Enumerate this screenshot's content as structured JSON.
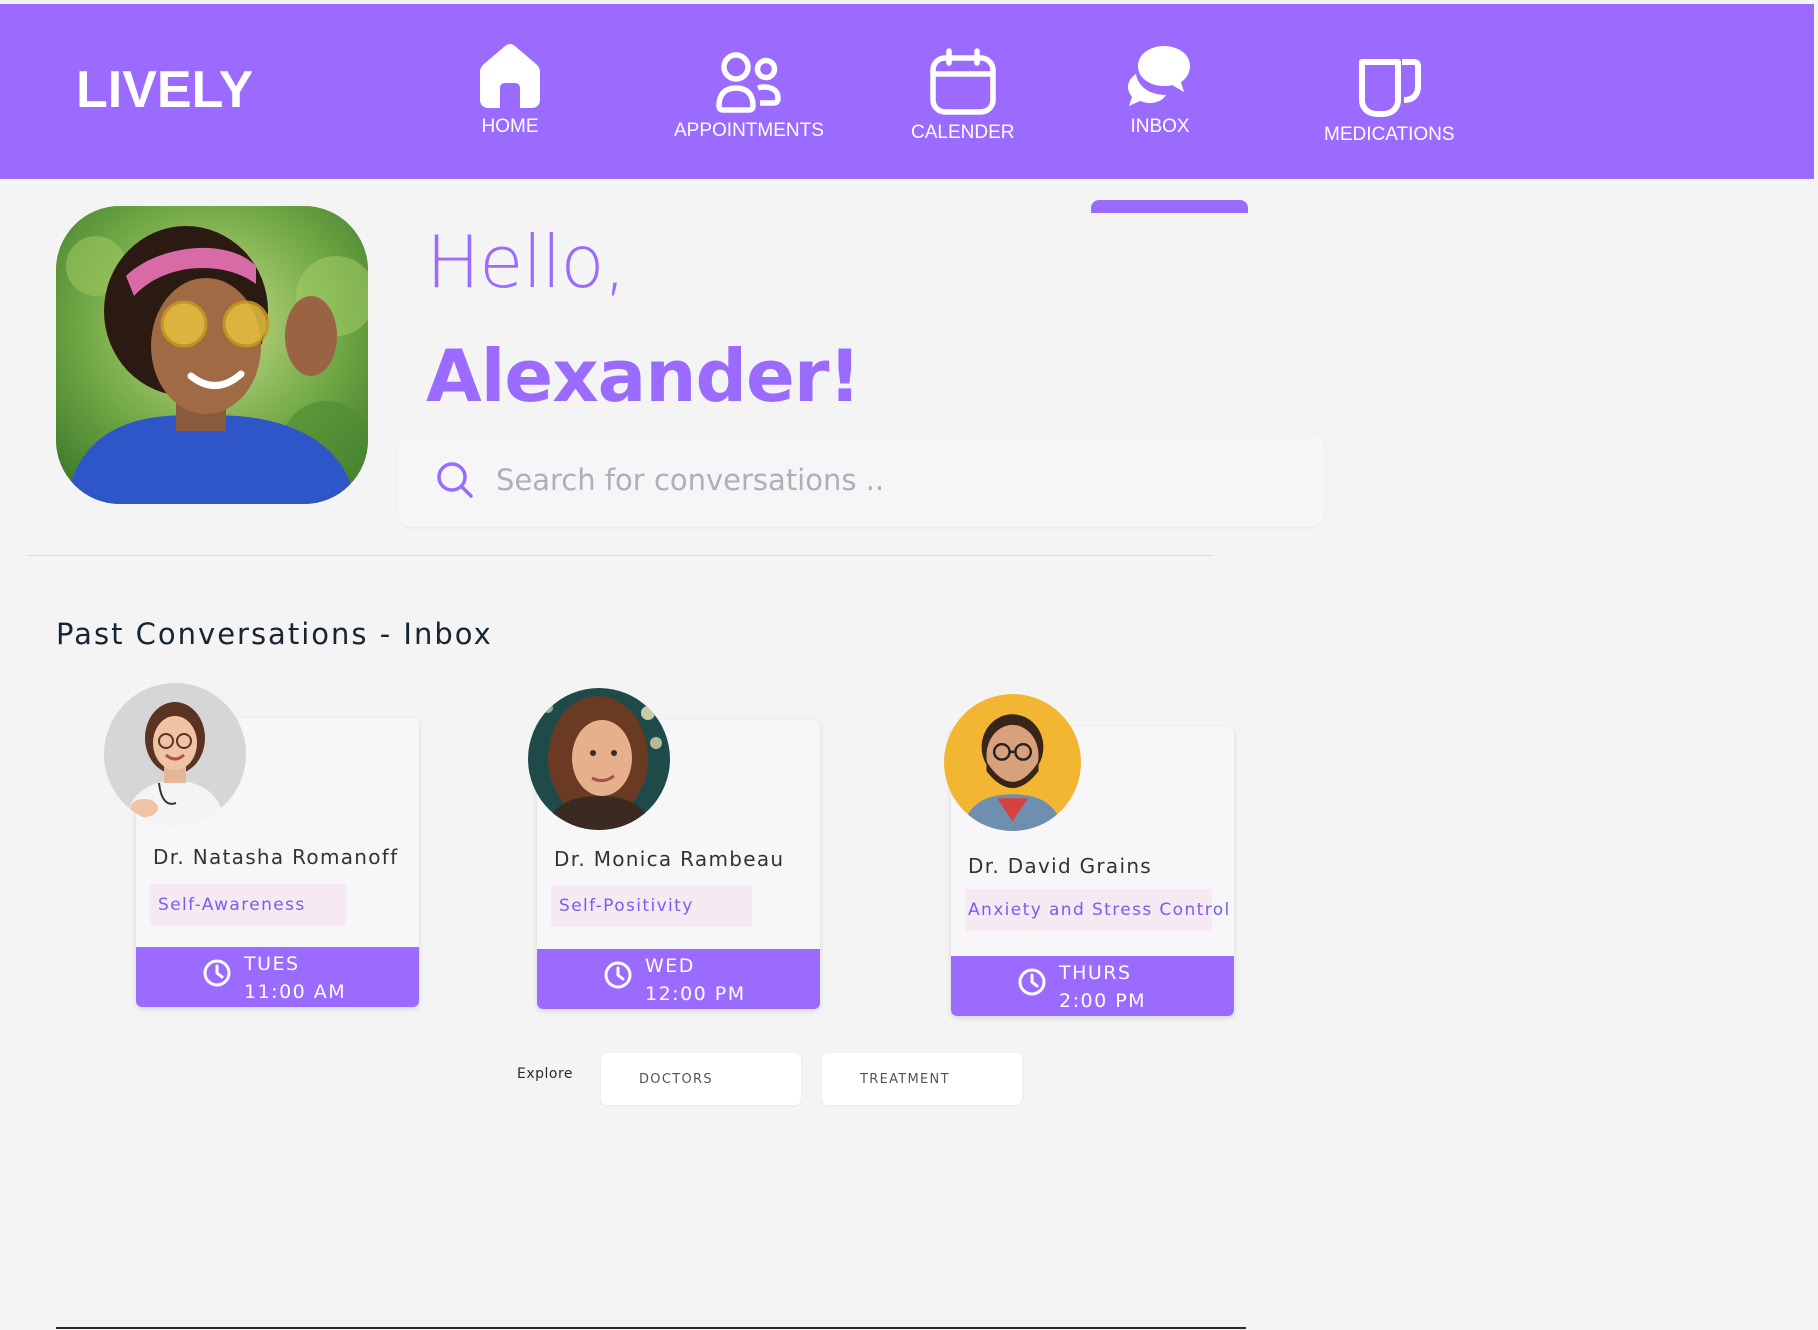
{
  "brand": {
    "logo": "LIVELY",
    "accent_color": "#9b6bff"
  },
  "nav": {
    "items": [
      {
        "label": "HOME",
        "icon": "home-icon"
      },
      {
        "label": "APPOINTMENTS",
        "icon": "users-icon"
      },
      {
        "label": "CALENDER",
        "icon": "calendar-icon"
      },
      {
        "label": "INBOX",
        "icon": "chat-bubbles-icon",
        "active": true
      },
      {
        "label": "MEDICATIONS",
        "icon": "medication-icon"
      }
    ]
  },
  "greeting": {
    "hello": "Hello,",
    "name": "Alexander!"
  },
  "search": {
    "placeholder": "Search for conversations ..",
    "value": ""
  },
  "section": {
    "title": "Past Conversations - Inbox"
  },
  "conversations": [
    {
      "doctor": "Dr. Natasha Romanoff",
      "tag": "Self-Awareness",
      "day": "TUES",
      "time": "11:00 AM"
    },
    {
      "doctor": "Dr. Monica Rambeau",
      "tag": "Self-Positivity",
      "day": "WED",
      "time": "12:00 PM"
    },
    {
      "doctor": "Dr. David Grains",
      "tag": "Anxiety and Stress Control",
      "day": "THURS",
      "time": "2:00 PM"
    }
  ],
  "explore": {
    "label": "Explore",
    "buttons": [
      "DOCTORS",
      "TREATMENT"
    ]
  }
}
